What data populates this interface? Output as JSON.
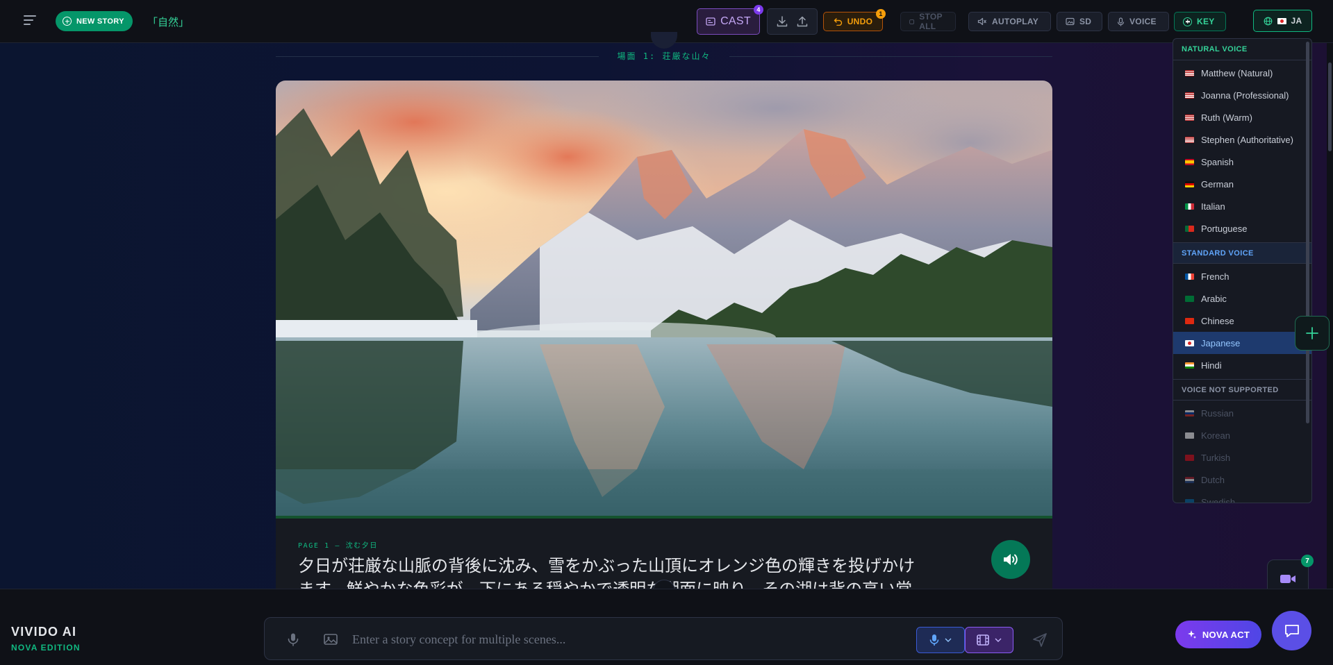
{
  "header": {
    "new_story_label": "NEW STORY",
    "story_title": "「自然」",
    "cast_label": "CAST",
    "cast_badge": "4",
    "undo_label": "UNDO",
    "undo_badge": "1",
    "stop_all_label": "STOP ALL",
    "autoplay_label": "AUTOPLAY",
    "sd_label": "SD",
    "voice_label": "VOICE",
    "key_label": "KEY",
    "language_label": "JA"
  },
  "scene": {
    "label": "場面 1: 荘厳な山々",
    "page_label": "PAGE 1 — 沈む夕日",
    "text": "夕日が荘厳な山脈の背後に沈み、雪をかぶった山頂にオレンジ色の輝きを投げかけます。鮮やかな色彩が、下にある穏やかで透明な湖面に映り、その湖は背の高い常"
  },
  "language_menu": {
    "natural_header": "NATURAL VOICE",
    "natural": [
      {
        "flag": "us",
        "label": "Matthew (Natural)"
      },
      {
        "flag": "us",
        "label": "Joanna (Professional)"
      },
      {
        "flag": "us",
        "label": "Ruth (Warm)"
      },
      {
        "flag": "us",
        "label": "Stephen (Authoritative)"
      },
      {
        "flag": "es",
        "label": "Spanish"
      },
      {
        "flag": "de",
        "label": "German"
      },
      {
        "flag": "it",
        "label": "Italian"
      },
      {
        "flag": "pt",
        "label": "Portuguese"
      }
    ],
    "standard_header": "STANDARD VOICE",
    "standard": [
      {
        "flag": "fr",
        "label": "French"
      },
      {
        "flag": "sa",
        "label": "Arabic"
      },
      {
        "flag": "cn",
        "label": "Chinese"
      },
      {
        "flag": "jp",
        "label": "Japanese",
        "selected": true
      },
      {
        "flag": "in",
        "label": "Hindi"
      }
    ],
    "unsupported_header": "VOICE NOT SUPPORTED",
    "unsupported": [
      {
        "flag": "ru",
        "label": "Russian"
      },
      {
        "flag": "kr",
        "label": "Korean"
      },
      {
        "flag": "tr",
        "label": "Turkish"
      },
      {
        "flag": "nl",
        "label": "Dutch"
      },
      {
        "flag": "se",
        "label": "Swedish"
      }
    ]
  },
  "video_badge": "7",
  "brand": {
    "name": "VIVIDO AI",
    "edition": "NOVA EDITION"
  },
  "composer": {
    "placeholder": "Enter a story concept for multiple scenes..."
  },
  "nova_act_label": "NOVA ACT",
  "colors": {
    "accent": "#10b981",
    "brand_green": "#059669",
    "purple": "#7c3aed",
    "amber": "#f59e0b",
    "selected_bg": "#1e3a6e"
  }
}
